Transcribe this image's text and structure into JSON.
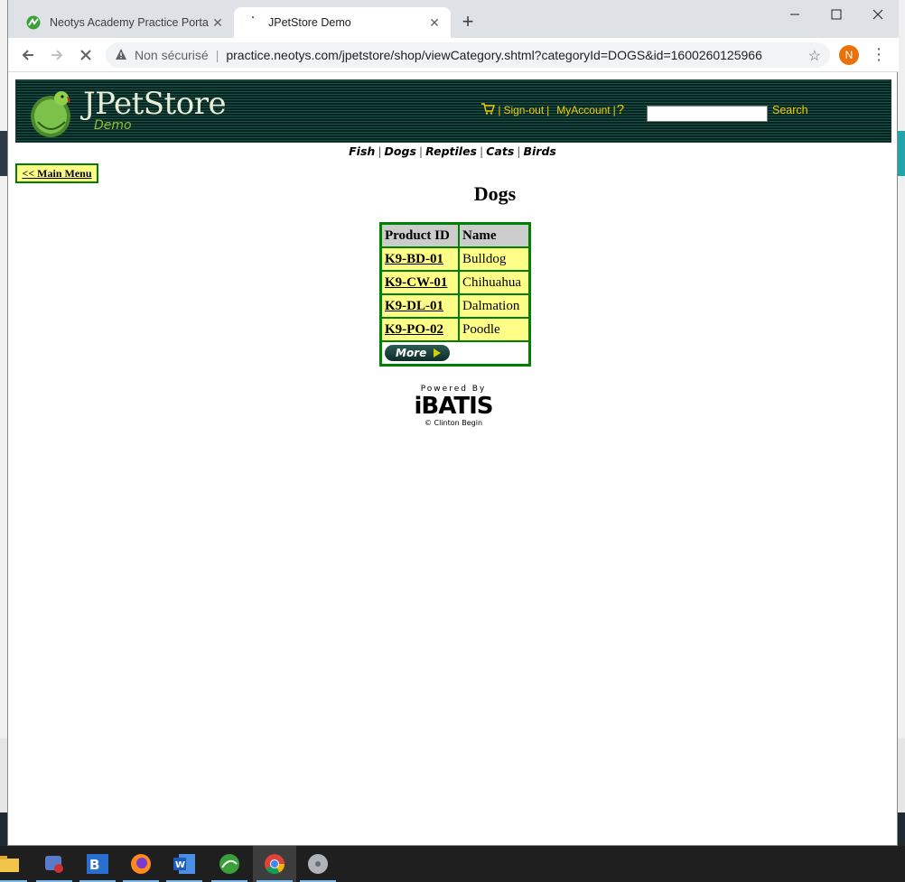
{
  "browser": {
    "tabs": [
      {
        "title": "Neotys Academy Practice Portal"
      },
      {
        "title": "JPetStore Demo"
      }
    ],
    "new_tab": "+",
    "address": {
      "security_label": "Non sécurisé",
      "url": "practice.neotys.com/jpetstore/shop/viewCategory.shtml?categoryId=DOGS&id=1600260125966"
    },
    "profile_initial": "N"
  },
  "header": {
    "logo_title": "JPetStore",
    "logo_subtitle": "Demo",
    "links": {
      "sign_out": "Sign-out",
      "my_account": "MyAccount",
      "help": "?"
    },
    "search_button": "Search",
    "search_value": ""
  },
  "quicklinks": [
    "Fish",
    "Dogs",
    "Reptiles",
    "Cats",
    "Birds"
  ],
  "main_menu_button": "<< Main Menu",
  "category": {
    "title": "Dogs",
    "columns": [
      "Product ID",
      "Name"
    ],
    "products": [
      {
        "id": "K9-BD-01",
        "name": "Bulldog"
      },
      {
        "id": "K9-CW-01",
        "name": "Chihuahua"
      },
      {
        "id": "K9-DL-01",
        "name": "Dalmation"
      },
      {
        "id": "K9-PO-02",
        "name": "Poodle"
      }
    ],
    "more_button": "More"
  },
  "footer": {
    "powered_by": "Powered By",
    "brand": "iBATIS",
    "credit": "© Clinton Begin"
  },
  "colors": {
    "header_bg": "#07261f",
    "link_yellow": "#f0d000",
    "cell_yellow": "#ffff88",
    "border_green": "#008000"
  }
}
